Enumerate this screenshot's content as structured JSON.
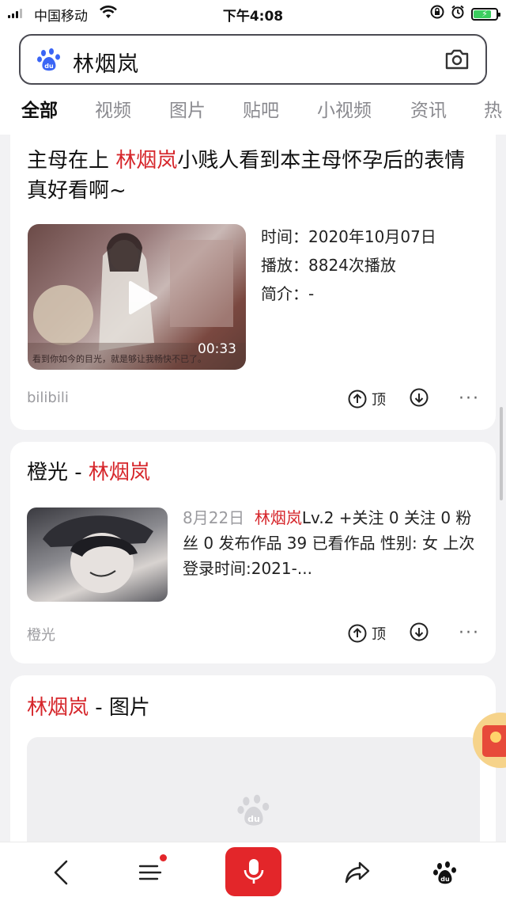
{
  "status_bar": {
    "carrier": "中国移动",
    "time": "下午4:08"
  },
  "search": {
    "query": "林烟岚"
  },
  "tabs": [
    {
      "label": "全部",
      "active": true
    },
    {
      "label": "视频",
      "active": false
    },
    {
      "label": "图片",
      "active": false
    },
    {
      "label": "贴吧",
      "active": false
    },
    {
      "label": "小视频",
      "active": false
    },
    {
      "label": "资讯",
      "active": false
    },
    {
      "label": "热",
      "active": false
    }
  ],
  "results": [
    {
      "title_prefix": "主母在上 ",
      "title_highlight": "林烟岚",
      "title_suffix": "小贱人看到本主母怀孕后的表情真好看啊~",
      "duration": "00:33",
      "video_caption": "看到你如今的目光，就是够让我畅快不已了。",
      "info": [
        {
          "label": "时间：",
          "value": "2020年10月07日"
        },
        {
          "label": "播放：",
          "value": "8824次播放"
        },
        {
          "label": "简介：",
          "value": "-"
        }
      ],
      "source": "bilibili",
      "upvote_label": "顶"
    },
    {
      "title_prefix": "橙光 - ",
      "title_highlight": "林烟岚",
      "title_suffix": "",
      "date": "8月22日",
      "desc_highlight": "林烟岚",
      "desc_text": "Lv.2 +关注 0 关注 0 粉丝 0 发布作品 39 已看作品 性别: 女 上次登录时间:2021-...",
      "source": "橙光",
      "upvote_label": "顶"
    },
    {
      "title_highlight": "林烟岚",
      "title_suffix": " - 图片"
    }
  ],
  "colors": {
    "highlight": "#d6262b",
    "accent": "#3a65f5",
    "mic": "#e3262a"
  }
}
